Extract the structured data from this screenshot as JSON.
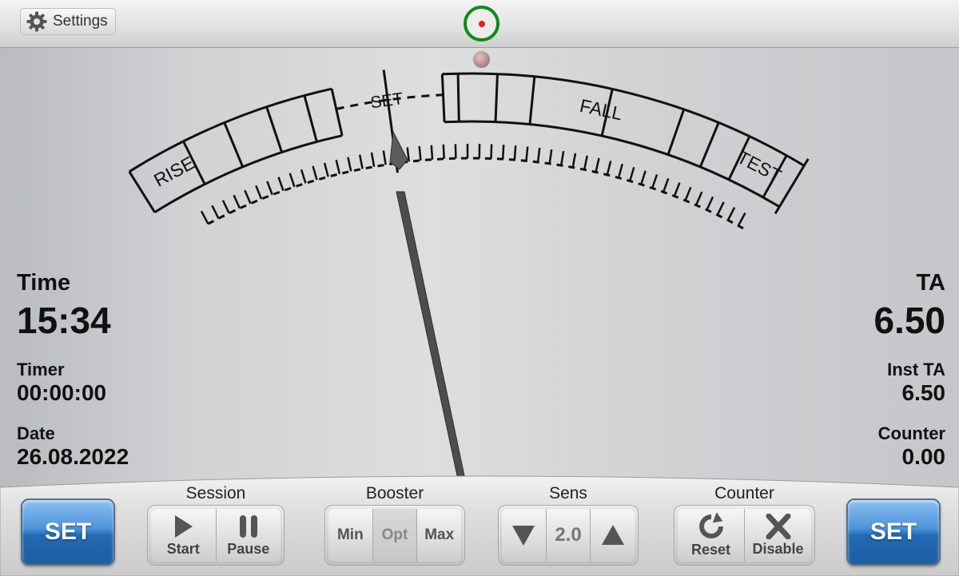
{
  "topbar": {
    "settings_label": "Settings"
  },
  "meter": {
    "scale_labels": {
      "rise": "RISE",
      "set": "SET",
      "fall": "FALL",
      "test": "TEST"
    }
  },
  "left_readouts": {
    "time_label": "Time",
    "time_value": "15:34",
    "timer_label": "Timer",
    "timer_value": "00:00:00",
    "date_label": "Date",
    "date_value": "26.08.2022"
  },
  "right_readouts": {
    "ta_label": "TA",
    "ta_value": "6.50",
    "inst_ta_label": "Inst TA",
    "inst_ta_value": "6.50",
    "counter_label": "Counter",
    "counter_value": "0.00"
  },
  "controls": {
    "set_left_label": "SET",
    "set_right_label": "SET",
    "session": {
      "title": "Session",
      "start_label": "Start",
      "pause_label": "Pause"
    },
    "booster": {
      "title": "Booster",
      "options": [
        "Min",
        "Opt",
        "Max"
      ],
      "selected": "Opt"
    },
    "sens": {
      "title": "Sens",
      "value": "2.0"
    },
    "counter": {
      "title": "Counter",
      "reset_label": "Reset",
      "disable_label": "Disable"
    }
  },
  "colors": {
    "indicator_ring": "#118a1d",
    "indicator_dot": "#e02020",
    "set_button": "#2a6fb8",
    "needle": "#4d4d4d"
  },
  "icons": [
    "gear-icon",
    "play-icon",
    "pause-icon",
    "down-triangle-icon",
    "up-triangle-icon",
    "reset-icon",
    "close-x-icon"
  ]
}
